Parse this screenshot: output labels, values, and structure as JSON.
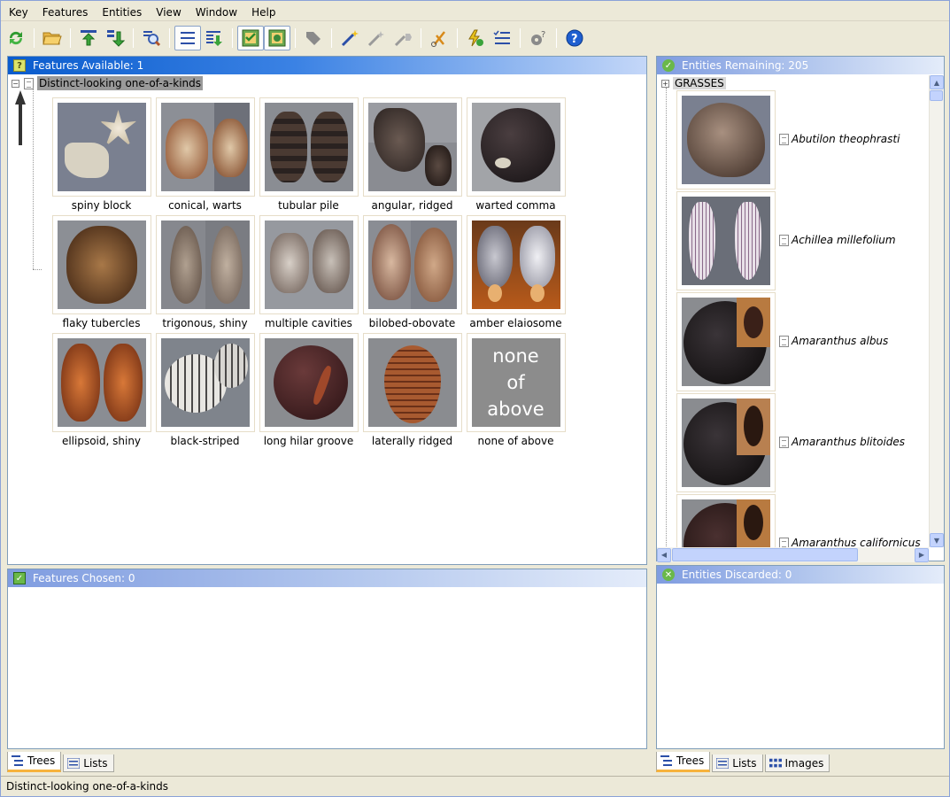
{
  "menu": [
    "Key",
    "Features",
    "Entities",
    "View",
    "Window",
    "Help"
  ],
  "toolbar": {
    "buttons": [
      "refresh-icon",
      "open-folder-icon",
      "move-up-icon",
      "move-down-icon",
      "find-icon",
      "list-view-icon",
      "tree-expand-icon",
      "image-view-icon",
      "image-view-2-icon",
      "tag-icon",
      "magic-wand-icon",
      "wand-icon",
      "wand-forward-icon",
      "scissors-icon",
      "lightning-icon",
      "checklist-icon",
      "gear-question-icon",
      "help-icon"
    ]
  },
  "features_available": {
    "title": "Features Available: 1",
    "root_label": "Distinct-looking one-of-a-kinds",
    "items": [
      {
        "label": "spiny block"
      },
      {
        "label": "conical, warts"
      },
      {
        "label": "tubular pile"
      },
      {
        "label": "angular, ridged"
      },
      {
        "label": "warted comma"
      },
      {
        "label": "flaky tubercles"
      },
      {
        "label": "trigonous, shiny"
      },
      {
        "label": "multiple cavities"
      },
      {
        "label": "bilobed-obovate"
      },
      {
        "label": "amber elaiosome"
      },
      {
        "label": "ellipsoid, shiny"
      },
      {
        "label": "black-striped"
      },
      {
        "label": "long hilar groove"
      },
      {
        "label": "laterally ridged"
      },
      {
        "label": "none of above"
      }
    ],
    "none_text": [
      "none",
      "of",
      "above"
    ]
  },
  "features_chosen": {
    "title": "Features Chosen: 0"
  },
  "entities_remaining": {
    "title": "Entities Remaining: 205",
    "group_label": "GRASSES",
    "items": [
      {
        "name": "Abutilon theophrasti"
      },
      {
        "name": "Achillea millefolium"
      },
      {
        "name": "Amaranthus albus"
      },
      {
        "name": "Amaranthus blitoides"
      },
      {
        "name": "Amaranthus californicus"
      }
    ]
  },
  "entities_discarded": {
    "title": "Entities Discarded: 0"
  },
  "left_tabs": [
    "Trees",
    "Lists"
  ],
  "right_tabs": [
    "Trees",
    "Lists",
    "Images"
  ],
  "status": "Distinct-looking one-of-a-kinds",
  "colors": {
    "header_active": "#0a5ccd",
    "header_inactive": "#7f9ce0",
    "tab_accent": "#f7b33c"
  }
}
